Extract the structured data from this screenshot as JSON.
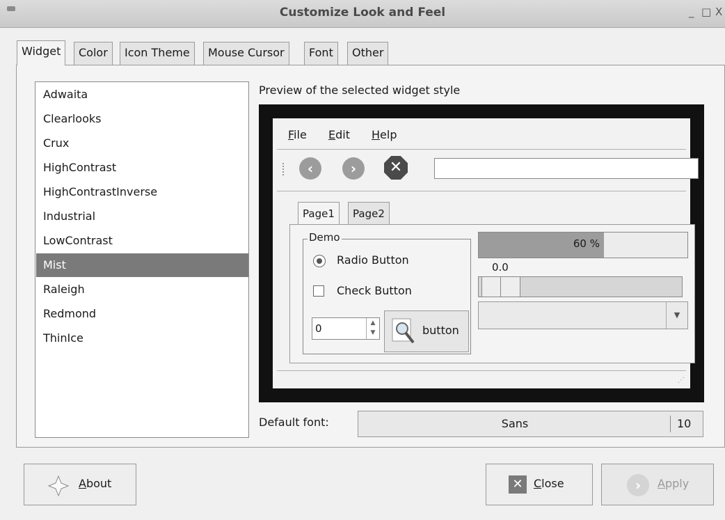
{
  "window": {
    "title": "Customize Look and Feel",
    "minimize_glyph": "_",
    "maximize_glyph": "□",
    "close_glyph": "X"
  },
  "tabs": [
    {
      "label": "Widget",
      "active": true
    },
    {
      "label": "Color",
      "active": false
    },
    {
      "label": "Icon Theme",
      "active": false
    },
    {
      "label": "Mouse Cursor",
      "active": false
    },
    {
      "label": "Font",
      "active": false
    },
    {
      "label": "Other",
      "active": false
    }
  ],
  "themes": {
    "items": [
      "Adwaita",
      "Clearlooks",
      "Crux",
      "HighContrast",
      "HighContrastInverse",
      "Industrial",
      "LowContrast",
      "Mist",
      "Raleigh",
      "Redmond",
      "ThinIce"
    ],
    "selected": "Mist"
  },
  "preview": {
    "label": "Preview of the selected widget style",
    "menu": [
      {
        "mnemonic": "F",
        "rest": "ile"
      },
      {
        "mnemonic": "E",
        "rest": "dit"
      },
      {
        "mnemonic": "H",
        "rest": "elp"
      }
    ],
    "toolbar_icons": [
      "back-icon",
      "forward-icon",
      "stop-icon"
    ],
    "url_value": "",
    "page_tabs": [
      {
        "label": "Page1",
        "active": true
      },
      {
        "label": "Page2",
        "active": false
      }
    ],
    "demo": {
      "legend": "Demo",
      "radio_label": "Radio Button",
      "radio_checked": true,
      "check_label": "Check Button",
      "check_checked": false,
      "spin_value": "0",
      "button_label": "button"
    },
    "progress": {
      "fraction": 0.6,
      "text": "60 %"
    },
    "scale_value": "0.0",
    "scale_fraction": 0.0,
    "combo_value": ""
  },
  "default_font": {
    "label": "Default font:",
    "family": "Sans",
    "size": "10"
  },
  "buttons": {
    "about": {
      "mnemonic": "A",
      "rest": "bout",
      "icon": "star-icon"
    },
    "close": {
      "mnemonic": "C",
      "rest": "lose",
      "icon": "close-icon"
    },
    "apply": {
      "mnemonic": "A",
      "rest": "pply",
      "icon": "apply-icon",
      "enabled": false
    }
  },
  "colors": {
    "selection": "#7a7a7a",
    "progress_fill": "#9c9c9c",
    "preview_frame": "#111111"
  }
}
